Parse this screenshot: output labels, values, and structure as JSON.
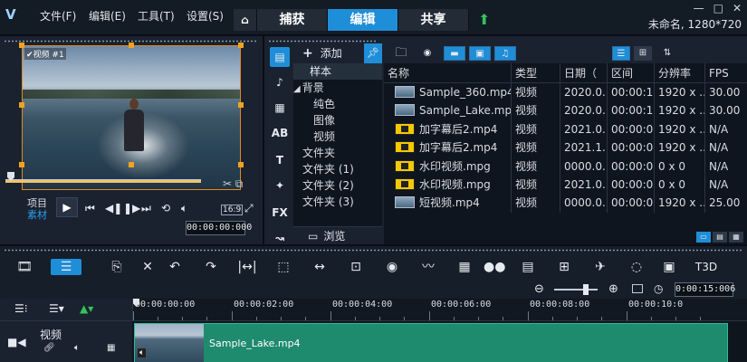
{
  "menu": {
    "file": "文件(F)",
    "edit": "编辑(E)",
    "tools": "工具(T)",
    "settings": "设置(S)"
  },
  "tabs": {
    "capture": "捕获",
    "edit": "编辑",
    "share": "共享"
  },
  "project": {
    "title": "未命名, 1280*720"
  },
  "preview": {
    "frame_label": "✔视频 #1",
    "mode_project": "项目",
    "mode_clip": "素材",
    "ratio": "16:9",
    "timecode": "00:00:00:000"
  },
  "library": {
    "add_label": "添加",
    "tree": [
      "样本",
      "背景",
      "纯色",
      "图像",
      "视频",
      "文件夹",
      "文件夹 (1)",
      "文件夹 (2)",
      "文件夹 (3)"
    ],
    "browse_label": "浏览",
    "columns": [
      "名称",
      "类型",
      "日期（",
      "区间",
      "分辨率",
      "FPS"
    ],
    "rows": [
      {
        "name": "Sample_360.mp4",
        "type": "视频",
        "date": "2020.0...",
        "area": "00:00:1...",
        "res": "1920 x ...",
        "fps": "30.00",
        "thumb": "lake"
      },
      {
        "name": "Sample_Lake.mp4",
        "type": "视频",
        "date": "2020.0...",
        "area": "00:00:1...",
        "res": "1920 x ...",
        "fps": "30.00",
        "thumb": "lake"
      },
      {
        "name": "加字幕后2.mp4",
        "type": "视频",
        "date": "2021.0...",
        "area": "00:00:0...",
        "res": "1920 x ...",
        "fps": "N/A",
        "thumb": "sub"
      },
      {
        "name": "加字幕后2.mp4",
        "type": "视频",
        "date": "2021.1...",
        "area": "00:00:0...",
        "res": "1920 x ...",
        "fps": "N/A",
        "thumb": "sub"
      },
      {
        "name": "水印视频.mpg",
        "type": "视频",
        "date": "0000.0...",
        "area": "00:00:0...",
        "res": "0 x 0",
        "fps": "N/A",
        "thumb": "sub"
      },
      {
        "name": "水印视频.mpg",
        "type": "视频",
        "date": "2021.0...",
        "area": "00:00:0...",
        "res": "0 x 0",
        "fps": "N/A",
        "thumb": "sub"
      },
      {
        "name": "短视频.mp4",
        "type": "视频",
        "date": "0000.0...",
        "area": "00:00:0...",
        "res": "1920 x ...",
        "fps": "25.00",
        "thumb": "lake"
      }
    ]
  },
  "timeline": {
    "zoom_time": "0:00:15:006",
    "ruler": [
      "00:00:00:00",
      "00:00:02:00",
      "00:00:04:00",
      "00:00:06:00",
      "00:00:08:00",
      "00:00:10:0"
    ],
    "track_label": "视频",
    "clip_name": "Sample_Lake.mp4"
  },
  "colors": {
    "accent": "#1f8ed8",
    "clip": "#1e8a6e",
    "handle": "#f2a21f"
  }
}
